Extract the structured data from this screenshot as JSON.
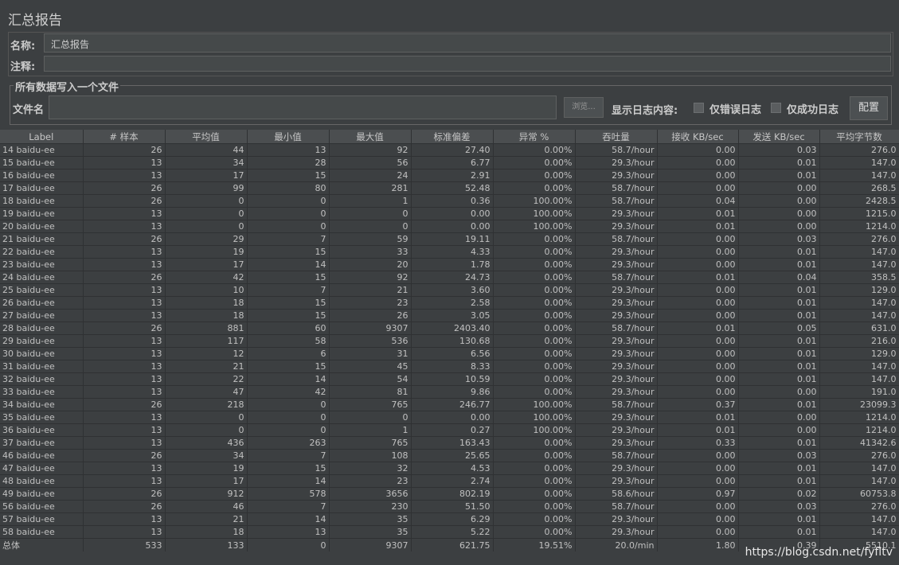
{
  "title": "汇总报告",
  "form": {
    "name_label": "名称:",
    "name_value": "汇总报告",
    "comment_label": "注释:",
    "comment_value": ""
  },
  "file_group": {
    "title": "所有数据写入一个文件",
    "file_label": "文件名",
    "file_value": "",
    "browse_label": "浏览...",
    "show_log_label": "显示日志内容:",
    "errors_only_label": "仅错误日志",
    "success_only_label": "仅成功日志",
    "config_label": "配置"
  },
  "table": {
    "columns": [
      "Label",
      "# 样本",
      "平均值",
      "最小值",
      "最大值",
      "标准偏差",
      "异常 %",
      "吞吐量",
      "接收 KB/sec",
      "发送 KB/sec",
      "平均字节数"
    ],
    "rows": [
      [
        "14 baidu-ee",
        "26",
        "44",
        "13",
        "92",
        "27.40",
        "0.00%",
        "58.7/hour",
        "0.00",
        "0.03",
        "276.0"
      ],
      [
        "15 baidu-ee",
        "13",
        "34",
        "28",
        "56",
        "6.77",
        "0.00%",
        "29.3/hour",
        "0.00",
        "0.01",
        "147.0"
      ],
      [
        "16 baidu-ee",
        "13",
        "17",
        "15",
        "24",
        "2.91",
        "0.00%",
        "29.3/hour",
        "0.00",
        "0.01",
        "147.0"
      ],
      [
        "17 baidu-ee",
        "26",
        "99",
        "80",
        "281",
        "52.48",
        "0.00%",
        "58.7/hour",
        "0.00",
        "0.00",
        "268.5"
      ],
      [
        "18 baidu-ee",
        "26",
        "0",
        "0",
        "1",
        "0.36",
        "100.00%",
        "58.7/hour",
        "0.04",
        "0.00",
        "2428.5"
      ],
      [
        "19 baidu-ee",
        "13",
        "0",
        "0",
        "0",
        "0.00",
        "100.00%",
        "29.3/hour",
        "0.01",
        "0.00",
        "1215.0"
      ],
      [
        "20 baidu-ee",
        "13",
        "0",
        "0",
        "0",
        "0.00",
        "100.00%",
        "29.3/hour",
        "0.01",
        "0.00",
        "1214.0"
      ],
      [
        "21 baidu-ee",
        "26",
        "29",
        "7",
        "59",
        "19.11",
        "0.00%",
        "58.7/hour",
        "0.00",
        "0.03",
        "276.0"
      ],
      [
        "22 baidu-ee",
        "13",
        "19",
        "15",
        "33",
        "4.33",
        "0.00%",
        "29.3/hour",
        "0.00",
        "0.01",
        "147.0"
      ],
      [
        "23 baidu-ee",
        "13",
        "17",
        "14",
        "20",
        "1.78",
        "0.00%",
        "29.3/hour",
        "0.00",
        "0.01",
        "147.0"
      ],
      [
        "24 baidu-ee",
        "26",
        "42",
        "15",
        "92",
        "24.73",
        "0.00%",
        "58.7/hour",
        "0.01",
        "0.04",
        "358.5"
      ],
      [
        "25 baidu-ee",
        "13",
        "10",
        "7",
        "21",
        "3.60",
        "0.00%",
        "29.3/hour",
        "0.00",
        "0.01",
        "129.0"
      ],
      [
        "26 baidu-ee",
        "13",
        "18",
        "15",
        "23",
        "2.58",
        "0.00%",
        "29.3/hour",
        "0.00",
        "0.01",
        "147.0"
      ],
      [
        "27 baidu-ee",
        "13",
        "18",
        "15",
        "26",
        "3.05",
        "0.00%",
        "29.3/hour",
        "0.00",
        "0.01",
        "147.0"
      ],
      [
        "28 baidu-ee",
        "26",
        "881",
        "60",
        "9307",
        "2403.40",
        "0.00%",
        "58.7/hour",
        "0.01",
        "0.05",
        "631.0"
      ],
      [
        "29 baidu-ee",
        "13",
        "117",
        "58",
        "536",
        "130.68",
        "0.00%",
        "29.3/hour",
        "0.00",
        "0.01",
        "216.0"
      ],
      [
        "30 baidu-ee",
        "13",
        "12",
        "6",
        "31",
        "6.56",
        "0.00%",
        "29.3/hour",
        "0.00",
        "0.01",
        "129.0"
      ],
      [
        "31 baidu-ee",
        "13",
        "21",
        "15",
        "45",
        "8.33",
        "0.00%",
        "29.3/hour",
        "0.00",
        "0.01",
        "147.0"
      ],
      [
        "32 baidu-ee",
        "13",
        "22",
        "14",
        "54",
        "10.59",
        "0.00%",
        "29.3/hour",
        "0.00",
        "0.01",
        "147.0"
      ],
      [
        "33 baidu-ee",
        "13",
        "47",
        "42",
        "81",
        "9.86",
        "0.00%",
        "29.3/hour",
        "0.00",
        "0.00",
        "191.0"
      ],
      [
        "34 baidu-ee",
        "26",
        "218",
        "0",
        "765",
        "246.77",
        "100.00%",
        "58.7/hour",
        "0.37",
        "0.01",
        "23099.3"
      ],
      [
        "35 baidu-ee",
        "13",
        "0",
        "0",
        "0",
        "0.00",
        "100.00%",
        "29.3/hour",
        "0.01",
        "0.00",
        "1214.0"
      ],
      [
        "36 baidu-ee",
        "13",
        "0",
        "0",
        "1",
        "0.27",
        "100.00%",
        "29.3/hour",
        "0.01",
        "0.00",
        "1214.0"
      ],
      [
        "37 baidu-ee",
        "13",
        "436",
        "263",
        "765",
        "163.43",
        "0.00%",
        "29.3/hour",
        "0.33",
        "0.01",
        "41342.6"
      ],
      [
        "46 baidu-ee",
        "26",
        "34",
        "7",
        "108",
        "25.65",
        "0.00%",
        "58.7/hour",
        "0.00",
        "0.03",
        "276.0"
      ],
      [
        "47 baidu-ee",
        "13",
        "19",
        "15",
        "32",
        "4.53",
        "0.00%",
        "29.3/hour",
        "0.00",
        "0.01",
        "147.0"
      ],
      [
        "48 baidu-ee",
        "13",
        "17",
        "14",
        "23",
        "2.74",
        "0.00%",
        "29.3/hour",
        "0.00",
        "0.01",
        "147.0"
      ],
      [
        "49 baidu-ee",
        "26",
        "912",
        "578",
        "3656",
        "802.19",
        "0.00%",
        "58.6/hour",
        "0.97",
        "0.02",
        "60753.8"
      ],
      [
        "56 baidu-ee",
        "26",
        "46",
        "7",
        "230",
        "51.50",
        "0.00%",
        "58.7/hour",
        "0.00",
        "0.03",
        "276.0"
      ],
      [
        "57 baidu-ee",
        "13",
        "21",
        "14",
        "35",
        "6.29",
        "0.00%",
        "29.3/hour",
        "0.00",
        "0.01",
        "147.0"
      ],
      [
        "58 baidu-ee",
        "13",
        "18",
        "13",
        "35",
        "5.22",
        "0.00%",
        "29.3/hour",
        "0.00",
        "0.01",
        "147.0"
      ]
    ],
    "total": [
      "总体",
      "533",
      "133",
      "0",
      "9307",
      "621.75",
      "19.51%",
      "20.0/min",
      "1.80",
      "0.39",
      "5510.1"
    ]
  },
  "watermark": "https://blog.csdn.net/fyfltv"
}
